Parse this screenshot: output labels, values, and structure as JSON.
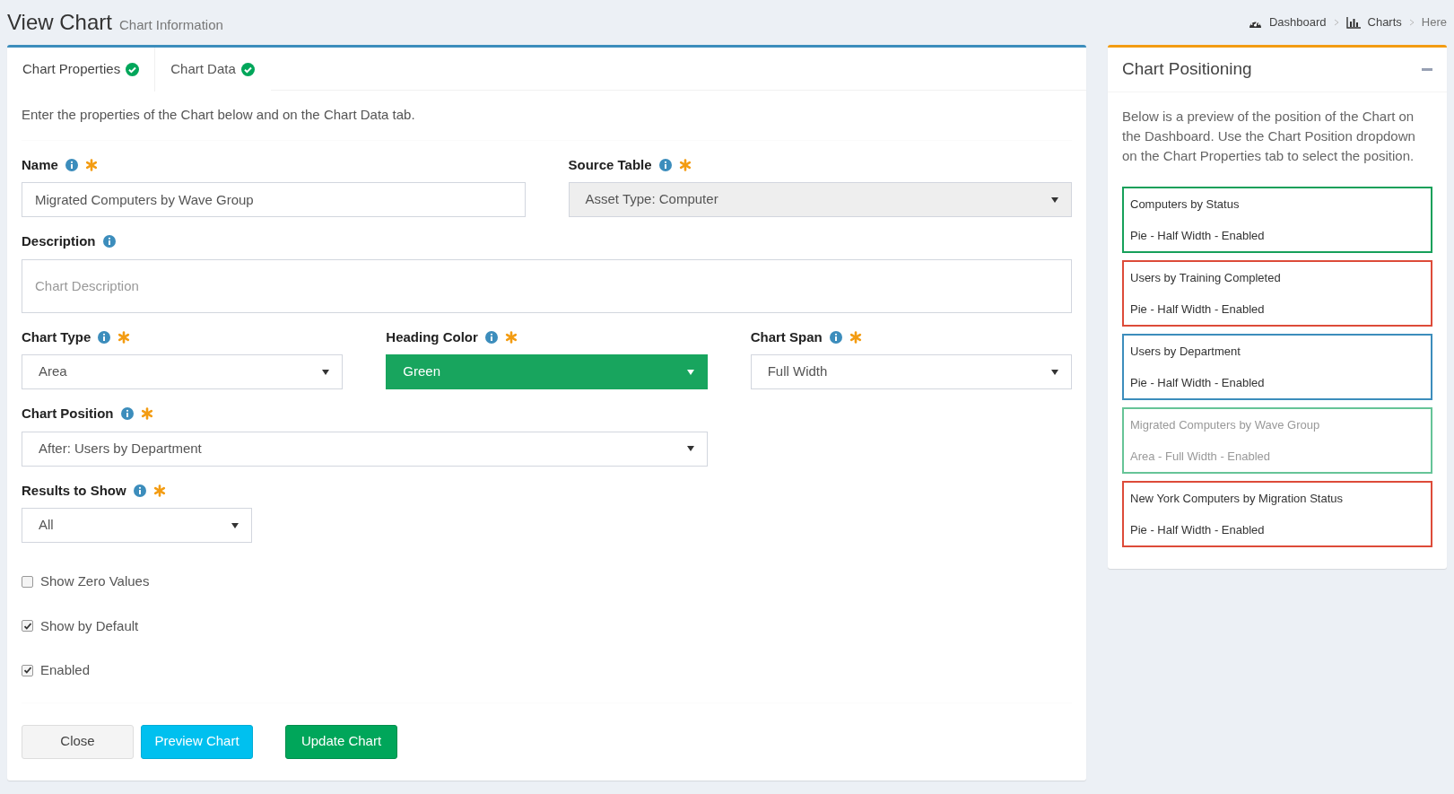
{
  "header": {
    "title": "View Chart",
    "subtitle": "Chart Information"
  },
  "breadcrumb": [
    {
      "label": "Dashboard"
    },
    {
      "label": "Charts"
    },
    {
      "label": "Here"
    }
  ],
  "tabs": [
    {
      "label": "Chart Properties",
      "selected": true,
      "complete": true
    },
    {
      "label": "Chart Data",
      "selected": false,
      "complete": true
    }
  ],
  "intro": "Enter the properties of the Chart below and on the Chart Data tab.",
  "form_rows": [
    [
      {
        "kind": "text",
        "label": "Name",
        "required": true,
        "value": "Migrated Computers by Wave Group",
        "disabled": false
      },
      {
        "kind": "select",
        "label": "Source Table",
        "required": true,
        "value": "Asset Type: Computer",
        "disabled": true
      }
    ],
    [
      {
        "kind": "textarea",
        "label": "Description",
        "required": false,
        "placeholder": "Chart Description",
        "disabled": false
      }
    ],
    [
      {
        "kind": "select",
        "label": "Chart Type",
        "required": true,
        "value": "Area",
        "disabled": false
      },
      {
        "kind": "select",
        "label": "Heading Color",
        "required": true,
        "value": "Green",
        "disabled": false,
        "color": "#18a55e"
      },
      {
        "kind": "select",
        "label": "Chart Span",
        "required": true,
        "value": "Full Width",
        "disabled": false
      }
    ],
    [
      {
        "kind": "select",
        "label": "Chart Position",
        "required": true,
        "value": "After: Users by Department",
        "disabled": false
      }
    ],
    [
      {
        "kind": "select",
        "label": "Results to Show",
        "required": true,
        "value": "All",
        "disabled": false
      }
    ]
  ],
  "checkboxes": [
    {
      "label": "Show Zero Values",
      "checked": false
    },
    {
      "label": "Show by Default",
      "checked": true
    },
    {
      "label": "Enabled",
      "checked": true
    }
  ],
  "buttons": [
    {
      "label": "Close",
      "kind": "default"
    },
    {
      "label": "Preview Chart",
      "kind": "info"
    },
    {
      "label": "Update Chart",
      "kind": "success"
    }
  ],
  "side_panel": {
    "title": "Chart Positioning",
    "description": "Below is a preview of the position of the Chart on the Dashboard. Use the Chart Position dropdown on the Chart Properties tab to select the position.",
    "charts": [
      {
        "name": "Computers by Status",
        "details": "Pie - Half Width - Enabled",
        "color": "#16a05a",
        "current": false
      },
      {
        "name": "Users by Training Completed",
        "details": "Pie - Half Width - Enabled",
        "color": "#dd4b39",
        "current": false
      },
      {
        "name": "Users by Department",
        "details": "Pie - Half Width - Enabled",
        "color": "#3c8dbc",
        "current": false
      },
      {
        "name": "Migrated Computers by Wave Group",
        "details": "Area - Full Width - Enabled",
        "color": "#66c497",
        "current": true
      },
      {
        "name": "New York Computers by Migration Status",
        "details": "Pie - Half Width - Enabled",
        "color": "#dd4b39",
        "current": false
      }
    ]
  }
}
